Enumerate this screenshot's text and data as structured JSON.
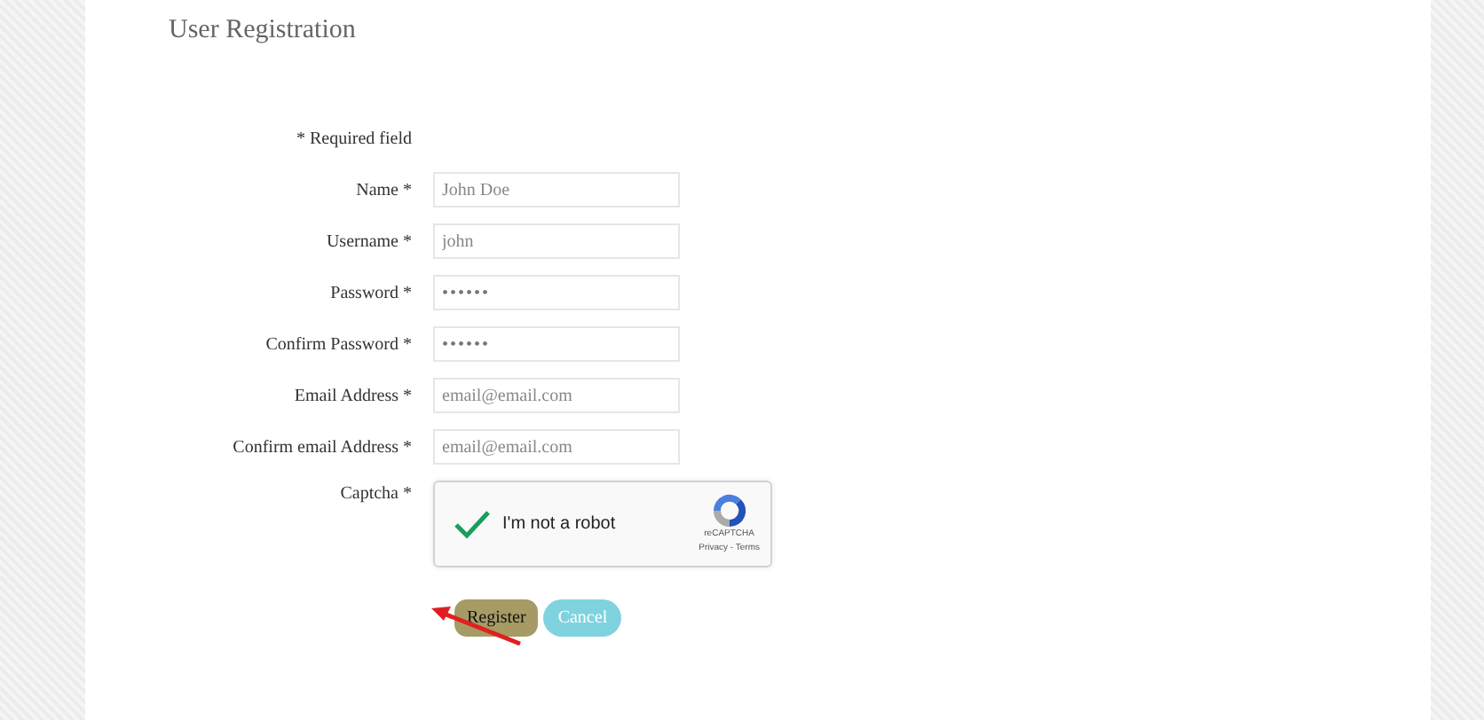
{
  "title": "User Registration",
  "required_note": "* Required field",
  "fields": [
    {
      "label": "Name *",
      "kind": "text",
      "placeholder": "John Doe"
    },
    {
      "label": "Username *",
      "kind": "text",
      "placeholder": "john"
    },
    {
      "label": "Password *",
      "kind": "password",
      "value": "••••••"
    },
    {
      "label": "Confirm Password *",
      "kind": "password",
      "value": "••••••"
    },
    {
      "label": "Email Address *",
      "kind": "text",
      "placeholder": "email@email.com"
    },
    {
      "label": "Confirm email Address *",
      "kind": "text",
      "placeholder": "email@email.com"
    }
  ],
  "captcha": {
    "label": "Captcha *",
    "checked": true,
    "text": "I'm not a robot",
    "brand": "reCAPTCHA",
    "links": "Privacy - Terms"
  },
  "buttons": [
    {
      "label": "Register",
      "kind": "primary"
    },
    {
      "label": "Cancel",
      "kind": "secondary"
    }
  ]
}
